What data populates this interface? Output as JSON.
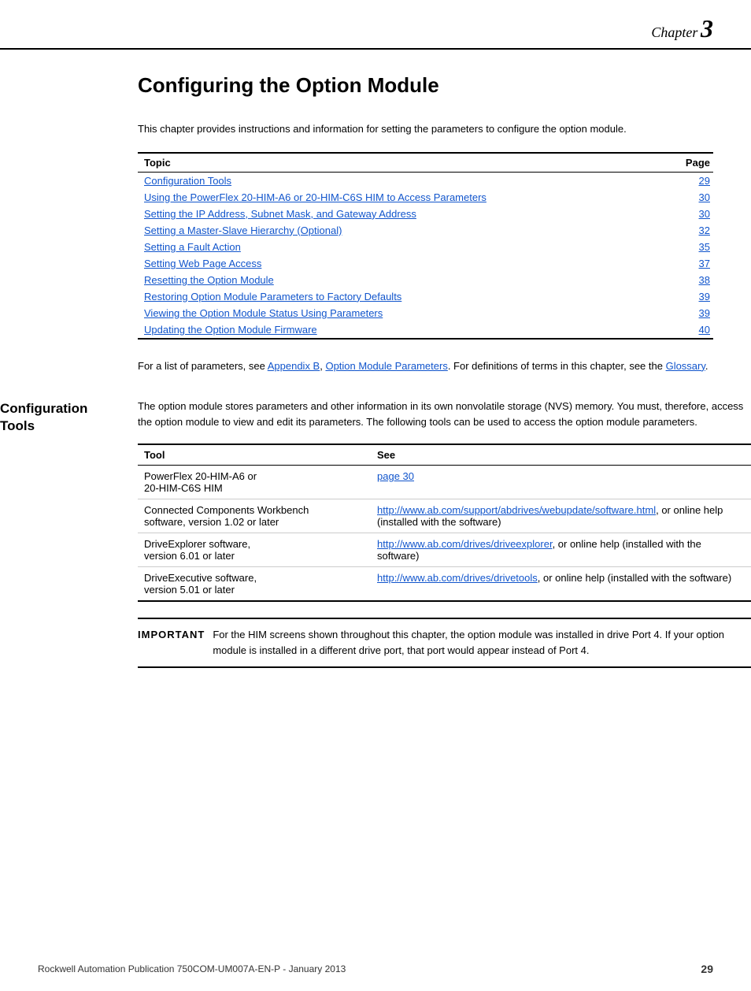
{
  "chapter": {
    "label": "Chapter",
    "number": "3"
  },
  "page_title": "Configuring the Option Module",
  "intro_text": "This chapter provides instructions and information for setting the parameters to configure the option module.",
  "toc": {
    "col_topic": "Topic",
    "col_page": "Page",
    "items": [
      {
        "label": "Configuration Tools",
        "page": "29"
      },
      {
        "label": "Using the PowerFlex 20-HIM-A6 or 20-HIM-C6S HIM to Access Parameters",
        "page": "30"
      },
      {
        "label": "Setting the IP Address, Subnet Mask, and Gateway Address",
        "page": "30"
      },
      {
        "label": "Setting a Master-Slave Hierarchy (Optional)",
        "page": "32"
      },
      {
        "label": "Setting a Fault Action",
        "page": "35"
      },
      {
        "label": "Setting Web Page Access",
        "page": "37"
      },
      {
        "label": "Resetting the Option Module",
        "page": "38"
      },
      {
        "label": "Restoring Option Module Parameters to Factory Defaults",
        "page": "39"
      },
      {
        "label": "Viewing the Option Module Status Using Parameters",
        "page": "39"
      },
      {
        "label": "Updating the Option Module Firmware",
        "page": "40"
      }
    ]
  },
  "appendix_note": "For a list of parameters, see Appendix B, Option Module Parameters. For definitions of terms in this chapter, see the Glossary.",
  "config_tools_section": {
    "sidebar_title": "Configuration Tools",
    "intro": "The option module stores parameters and other information in its own nonvolatile storage (NVS) memory. You must, therefore, access the option module to view and edit its parameters. The following tools can be used to access the option module parameters.",
    "table": {
      "col_tool": "Tool",
      "col_see": "See",
      "rows": [
        {
          "tool": "PowerFlex 20-HIM-A6 or\n20-HIM-C6S HIM",
          "see_text": "page 30",
          "see_link": true
        },
        {
          "tool": "Connected Components Workbench\nsoftware, version 1.02 or later",
          "see_text": "http://www.ab.com/support/abdrives/webupdate/software.html, or online help (installed with the software)",
          "see_link": true
        },
        {
          "tool": "DriveExplorer software,\nversion 6.01 or later",
          "see_text": "http://www.ab.com/drives/driveexplorer, or online help (installed with the software)",
          "see_link": true
        },
        {
          "tool": "DriveExecutive software,\nversion 5.01 or later",
          "see_text": "http://www.ab.com/drives/drivetools, or online help (installed with the software)",
          "see_link": true
        }
      ]
    }
  },
  "important_box": {
    "label": "IMPORTANT",
    "text": "For the HIM screens shown throughout this chapter, the option module was installed in drive Port 4. If your option module is installed in a different drive port, that port would appear instead of Port 4."
  },
  "footer": {
    "left": "Rockwell Automation Publication 750COM-UM007A-EN-P - January 2013",
    "right": "29"
  }
}
